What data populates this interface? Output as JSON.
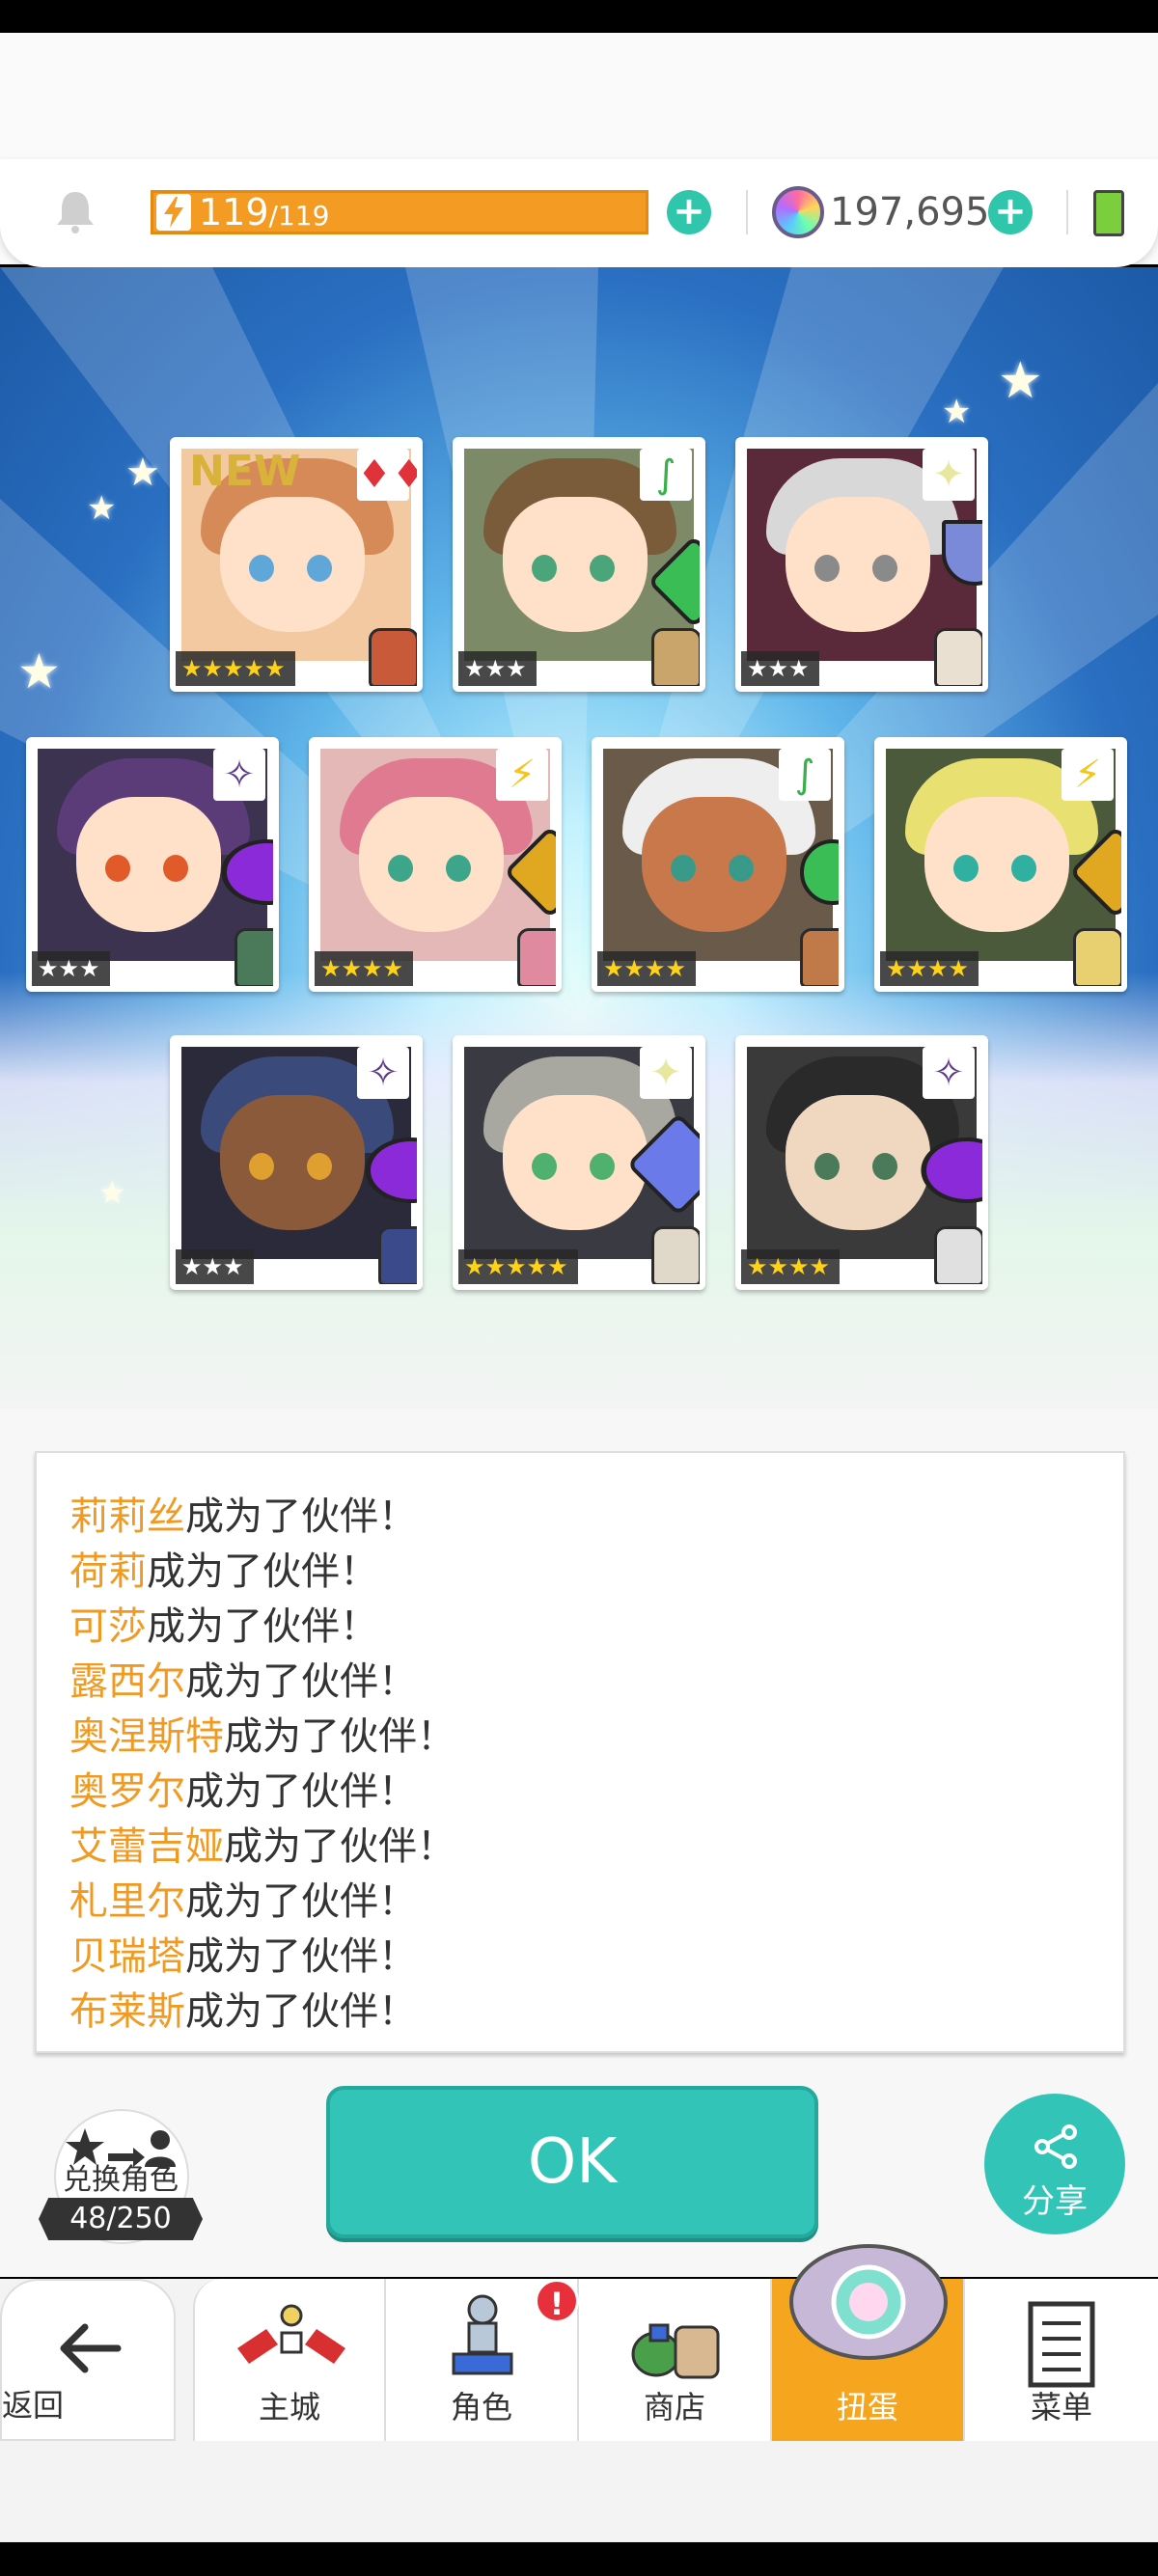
{
  "hud": {
    "stamina_current": "119",
    "stamina_max": "/119",
    "gems": "197,695",
    "plus_symbol": "+"
  },
  "cards": [
    {
      "rarity": "★★★★★",
      "element": "♦♦",
      "new": "NEW",
      "gold": true
    },
    {
      "rarity": "★★★",
      "element": "∫",
      "new": "",
      "gold": false
    },
    {
      "rarity": "★★★",
      "element": "✦",
      "new": "",
      "gold": false
    },
    {
      "rarity": "★★★",
      "element": "✧",
      "new": "",
      "gold": false
    },
    {
      "rarity": "★★★★",
      "element": "⚡",
      "new": "",
      "gold": true
    },
    {
      "rarity": "★★★★",
      "element": "∫",
      "new": "",
      "gold": true
    },
    {
      "rarity": "★★★★",
      "element": "⚡",
      "new": "",
      "gold": true
    },
    {
      "rarity": "★★★",
      "element": "✧",
      "new": "",
      "gold": false
    },
    {
      "rarity": "★★★★★",
      "element": "✦",
      "new": "",
      "gold": true
    },
    {
      "rarity": "★★★★",
      "element": "✧",
      "new": "",
      "gold": true
    }
  ],
  "messages": {
    "suffix": "成为了伙伴！",
    "lines": [
      {
        "name": "莉莉丝"
      },
      {
        "name": "荷莉"
      },
      {
        "name": "可莎"
      },
      {
        "name": "露西尔"
      },
      {
        "name": "奥涅斯特"
      },
      {
        "name": "奥罗尔"
      },
      {
        "name": "艾蕾吉娅"
      },
      {
        "name": "札里尔"
      },
      {
        "name": "贝瑞塔"
      },
      {
        "name": "布莱斯"
      }
    ]
  },
  "exchange": {
    "label": "兑换角色",
    "count": "48/250"
  },
  "ok_label": "OK",
  "share_label": "分享",
  "nav": {
    "back": "返回",
    "main_city": "主城",
    "characters": "角色",
    "shop": "商店",
    "gacha": "扭蛋",
    "menu": "菜单",
    "alert_badge": "!"
  },
  "colors": {
    "accent_teal": "#32c5b7",
    "stamina_orange": "#f49b23",
    "name_orange": "#f19a22",
    "active_tab": "#f6a51f"
  }
}
